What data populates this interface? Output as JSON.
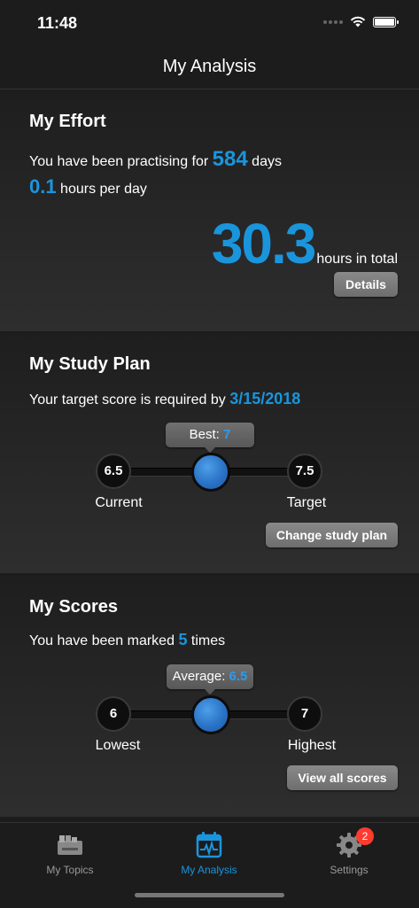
{
  "status": {
    "time": "11:48"
  },
  "nav": {
    "title": "My Analysis"
  },
  "effort": {
    "title": "My Effort",
    "line1_prefix": "You have been practising for",
    "days": "584",
    "line1_suffix": "days",
    "per_day": "0.1",
    "per_day_suffix": "hours per day",
    "total": "30.3",
    "total_suffix": "hours in total",
    "details_button": "Details"
  },
  "plan": {
    "title": "My Study Plan",
    "line_prefix": "Your target score is required by",
    "date": "3/15/2018",
    "best_label": "Best:",
    "best_value": "7",
    "current_value": "6.5",
    "current_label": "Current",
    "target_value": "7.5",
    "target_label": "Target",
    "change_button": "Change study plan"
  },
  "scores": {
    "title": "My Scores",
    "line_prefix": "You have been marked",
    "count": "5",
    "line_suffix": "times",
    "average_label": "Average:",
    "average_value": "6.5",
    "lowest_value": "6",
    "lowest_label": "Lowest",
    "highest_value": "7",
    "highest_label": "Highest",
    "view_button": "View all scores"
  },
  "tabs": [
    {
      "label": "My Topics",
      "icon": "topics-icon",
      "active": false
    },
    {
      "label": "My Analysis",
      "icon": "analysis-icon",
      "active": true
    },
    {
      "label": "Settings",
      "icon": "gear-icon",
      "active": false,
      "badge": "2"
    }
  ],
  "colors": {
    "accent": "#1a95dc",
    "badge": "#ff3b30",
    "background": "#1c1c1c"
  }
}
